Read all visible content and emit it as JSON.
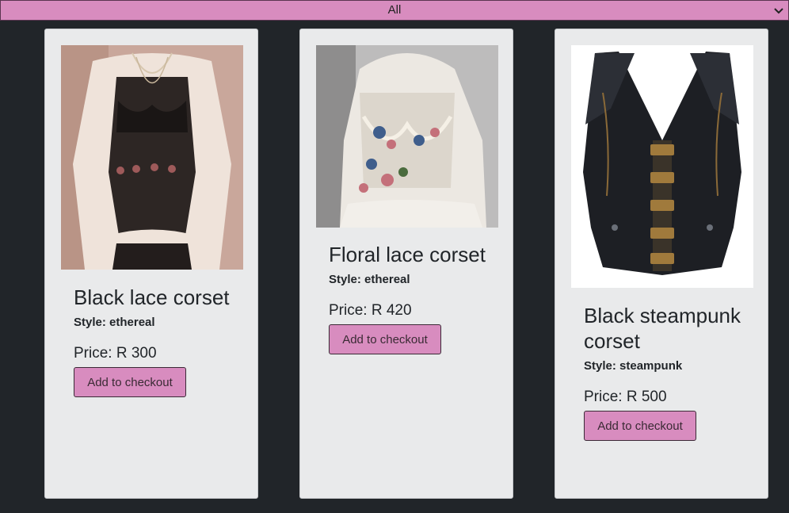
{
  "filter": {
    "selected": "All",
    "icon": "chevron-down-icon"
  },
  "colors": {
    "page_background": "#212529",
    "card_background": "#e9eaeb",
    "accent": "#d88cbf"
  },
  "products": [
    {
      "name": "Black lace corset",
      "style_label": "Style: ethereal",
      "price_label": "Price: R 300",
      "button_label": "Add to checkout",
      "image": "black-lace-corset-photo"
    },
    {
      "name": "Floral lace corset",
      "style_label": "Style: ethereal",
      "price_label": "Price: R 420",
      "button_label": "Add to checkout",
      "image": "floral-lace-corset-photo"
    },
    {
      "name": "Black steampunk corset",
      "style_label": "Style: steampunk",
      "price_label": "Price: R 500",
      "button_label": "Add to checkout",
      "image": "black-steampunk-corset-photo"
    }
  ]
}
